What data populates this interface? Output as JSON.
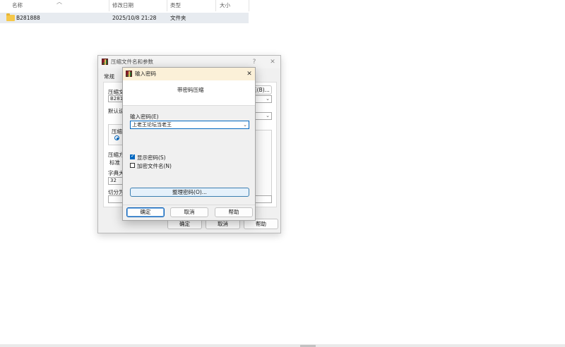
{
  "explorer": {
    "columns": {
      "name": "名称",
      "date": "修改日期",
      "type": "类型",
      "size": "大小"
    },
    "rows": [
      {
        "name": "B281888",
        "date": "2025/10/8 21:28",
        "type": "文件夹",
        "size": ""
      }
    ]
  },
  "main_dialog": {
    "title": "压缩文件名和参数",
    "help_symbol": "?",
    "close_symbol": "✕",
    "tab_general": "常规",
    "archive_name_label": "压缩文",
    "archive_name_value": "B28188",
    "browse_label": "览(B)...",
    "profile_label": "默认设",
    "format_group_label": "压缩",
    "radio_partial": "R",
    "method_label": "压缩方",
    "method_value": "标准",
    "dict_label": "字典大",
    "dict_value": "32",
    "split_label": "切分为",
    "ok_label": "确定",
    "cancel_label": "取消",
    "help_label": "帮助"
  },
  "password_dialog": {
    "title": "输入密码",
    "close_symbol": "✕",
    "header_text": "带密码压缩",
    "enter_password_label": "输入密码(E)",
    "password_value": "上老王论坛当老王",
    "show_password_label": "显示密码(S)",
    "show_password_checked": true,
    "encrypt_names_label": "加密文件名(N)",
    "encrypt_names_checked": false,
    "organize_label": "整理密码(O)...",
    "ok_label": "确定",
    "cancel_label": "取消",
    "help_label": "帮助"
  },
  "icons": {
    "folder": "folder-icon",
    "winrar": "winrar-icon",
    "combo": "chevron-down-icon"
  }
}
